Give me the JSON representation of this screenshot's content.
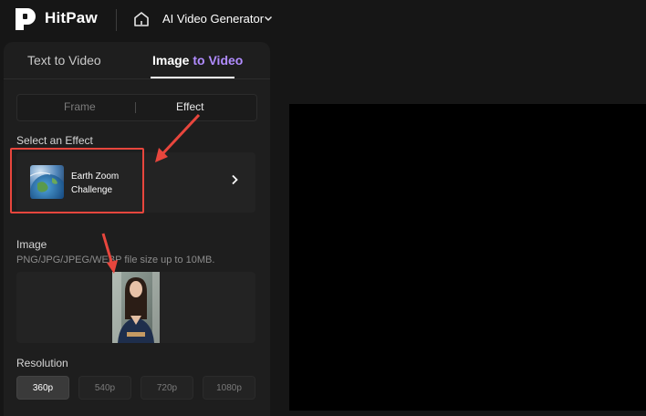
{
  "header": {
    "brand": "HitPaw",
    "nav_title": "AI Video Generator"
  },
  "tabs": {
    "text_to_video": "Text to Video",
    "image_to_video_prefix": "Image ",
    "image_to_video_highlight": "to Video"
  },
  "mode_toggle": {
    "frame": "Frame",
    "effect": "Effect"
  },
  "effect_section": {
    "label": "Select an Effect",
    "selected_effect_line1": "Earth Zoom",
    "selected_effect_line2": "Challenge"
  },
  "image_section": {
    "label": "Image",
    "hint": "PNG/JPG/JPEG/WEBP file size up to 10MB."
  },
  "resolution_section": {
    "label": "Resolution",
    "options": [
      "360p",
      "540p",
      "720p",
      "1080p"
    ],
    "selected": "360p"
  },
  "colors": {
    "accent": "#b18cff",
    "annotation": "#e8463d",
    "background": "#161616",
    "panel": "#1e1e1e"
  },
  "icons": [
    "hitpaw-logo-icon",
    "home-icon",
    "chevron-down-icon",
    "chevron-right-icon",
    "earth-thumbnail",
    "portrait-photo"
  ]
}
